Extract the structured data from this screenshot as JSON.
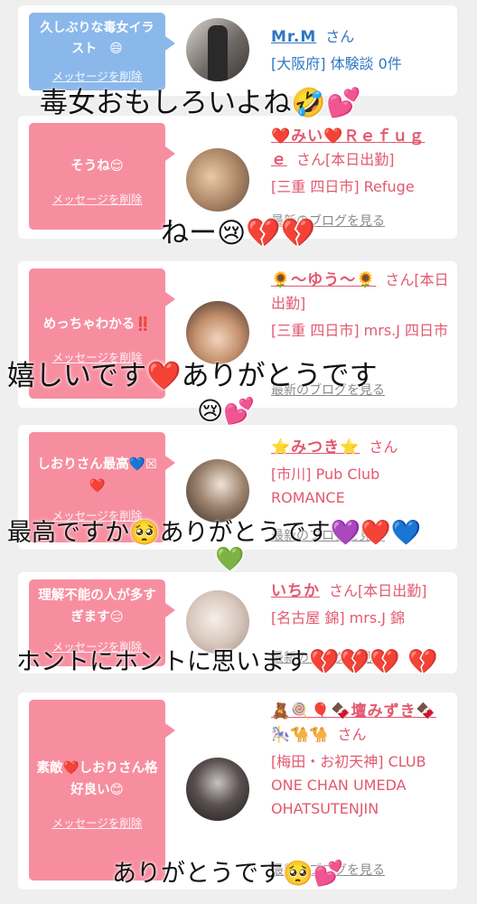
{
  "cards": [
    {
      "message": "久しぶりな毒女イラスト　😄",
      "delete_label": "メッセージを削除",
      "name": "Mr.M",
      "san": "さん",
      "line2": "[大阪府] 体験談 0件",
      "blog_link": ""
    },
    {
      "message": "そうね😌",
      "delete_label": "メッセージを削除",
      "name": "❤️みい❤️Ｒｅｆｕｇｅ",
      "san": "さん[本日出勤]",
      "line2": "[三重 四日市] Refuge",
      "blog_link": "最新のブログを見る"
    },
    {
      "message": "めっちゃわかる‼️",
      "delete_label": "メッセージを削除",
      "name": "🌻〜ゆう〜🌻",
      "san": "さん[本日出勤]",
      "line2": "[三重 四日市] mrs.J 四日市",
      "blog_link": "最新のブログを見る"
    },
    {
      "message": "しおりさん最高💙☒❤️",
      "delete_label": "メッセージを削除",
      "name": "⭐みつき⭐",
      "san": "さん",
      "line2": "[市川] Pub Club ROMANCE",
      "blog_link": "最新のブログを見る"
    },
    {
      "message": "理解不能の人が多すぎます😑",
      "delete_label": "メッセージを削除",
      "name": "いちか",
      "san": "さん[本日出勤]",
      "line2": "[名古屋 錦] mrs.J 錦",
      "blog_link": "最新のブログを見る"
    },
    {
      "message": "素敵❤️しおりさん格好良い😊",
      "delete_label": "メッセージを削除",
      "name": "🧸🍭🎈🍫壇みずき🍫",
      "name2": "🎠🐪🐪",
      "san": "さん",
      "line2": "[梅田・お初天神] CLUB ONE CHAN UMEDA OHATSUTENJIN",
      "blog_link": "最新のブログを見る"
    }
  ],
  "overlays": {
    "o1": "毒女おもしろいよね🤣💕",
    "o2": "ねー😢💔💔",
    "o3": "嬉しいです❤️ありがとうです",
    "o3b": "😢💕",
    "o4": "最高ですか🥺ありがとうです💜❤️💙",
    "o4b": "💚",
    "o5": "ホントにホントに思います💔💔💔 💔",
    "o6": "ありがとうです🥺💕"
  }
}
